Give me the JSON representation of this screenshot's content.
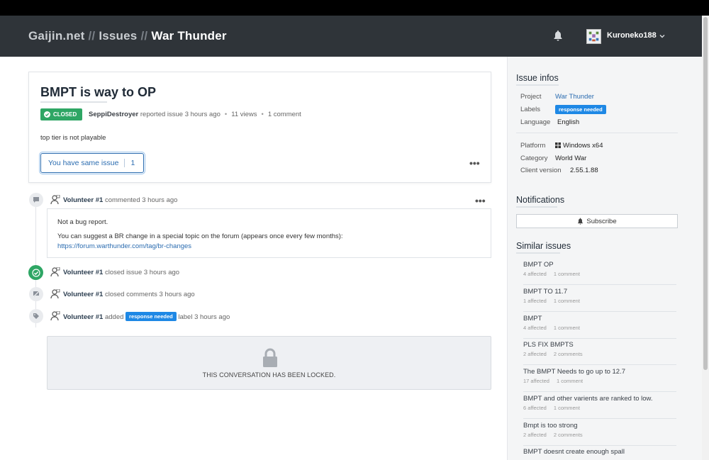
{
  "header": {
    "crumb_site": "Gaijin.net",
    "crumb_sep": "//",
    "crumb_section": "Issues",
    "crumb_project": "War Thunder",
    "username": "Kuroneko188",
    "icons": [
      "bell-icon",
      "avatar",
      "chevron-down-icon"
    ]
  },
  "issue": {
    "title": "BMPT is way to OP",
    "status": "CLOSED",
    "author": "SeppiDestroyer",
    "reported_text": "reported issue 3 hours ago",
    "views": "11 views",
    "comments": "1 comment",
    "description": "top tier is not playable",
    "same_issue_label": "You have same issue",
    "same_issue_count": "1",
    "colors": {
      "closed": "#2ea664",
      "accent": "#2b6cb0",
      "label": "#1e88e5"
    }
  },
  "timeline": {
    "comment": {
      "user": "Volunteer #1",
      "action": "commented 3 hours ago",
      "line1": "Not a bug report.",
      "line2": "You can suggest a BR change in a special topic on the forum (appears once every few months):",
      "link": "https://forum.warthunder.com/tag/br-changes"
    },
    "closed": {
      "user": "Volunteer #1",
      "action": "closed issue 3 hours ago"
    },
    "closed_comments": {
      "user": "Volunteer #1",
      "action": "closed comments 3 hours ago"
    },
    "label": {
      "user": "Volunteer #1",
      "added": "added",
      "label": "response needed",
      "suffix": "label 3 hours ago"
    },
    "locked_text": "THIS CONVERSATION HAS BEEN LOCKED."
  },
  "sidebar": {
    "infos_title": "Issue infos",
    "project_label": "Project",
    "project_value": "War Thunder",
    "labels_label": "Labels",
    "labels_value": "response needed",
    "language_label": "Language",
    "language_value": "English",
    "platform_label": "Platform",
    "platform_value": "Windows x64",
    "category_label": "Category",
    "category_value": "World War",
    "client_label": "Client version",
    "client_value": "2.55.1.88",
    "notifications_title": "Notifications",
    "subscribe_label": "Subscribe",
    "similar_title": "Similar issues",
    "similar": [
      {
        "title": "BMPT OP",
        "affected": "4 affected",
        "comments": "1 comment"
      },
      {
        "title": "BMPT TO 11.7",
        "affected": "1 affected",
        "comments": "1 comment"
      },
      {
        "title": "BMPT",
        "affected": "4 affected",
        "comments": "1 comment"
      },
      {
        "title": "PLS FIX BMPTS",
        "affected": "2 affected",
        "comments": "2 comments"
      },
      {
        "title": "The BMPT Needs to go up to 12.7",
        "affected": "17 affected",
        "comments": "1 comment"
      },
      {
        "title": "BMPT and other varients are ranked to low.",
        "affected": "6 affected",
        "comments": "1 comment"
      },
      {
        "title": "Bmpt is too strong",
        "affected": "2 affected",
        "comments": "2 comments"
      },
      {
        "title": "BMPT doesnt create enough spall",
        "affected": "",
        "comments": ""
      }
    ]
  }
}
